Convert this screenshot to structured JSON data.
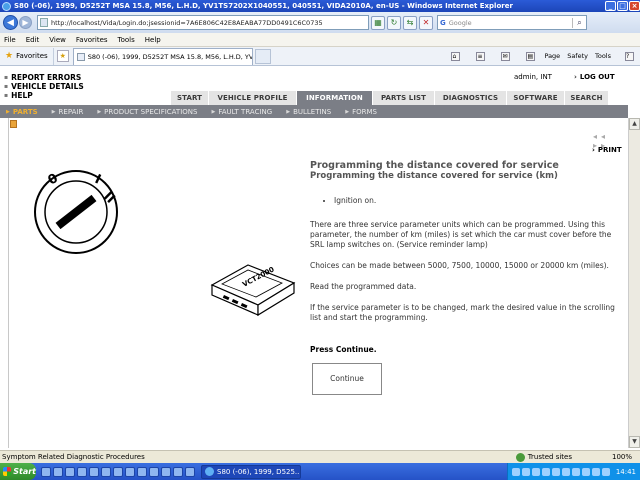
{
  "window": {
    "title": "S80 (-06), 1999, D5252T MSA 15.8, M56, L.H.D, YV1TS7202X1040551, 040551, VIDA2010A, en-US - Windows Internet Explorer"
  },
  "address_bar": {
    "url": "http://localhost/Vida/Login.do;jsessionid=7A6E806C42E8AEABA77DD0491C6C0735",
    "search_placeholder": "Google"
  },
  "menu": [
    "File",
    "Edit",
    "View",
    "Favorites",
    "Tools",
    "Help"
  ],
  "favorites": {
    "label": "Favorites",
    "tab_title": "S80 (-06), 1999, D5252T MSA 15.8, M56, L.H.D, YV1...",
    "commands": [
      "Page",
      "Safety",
      "Tools"
    ]
  },
  "app": {
    "left_links": [
      "REPORT ERRORS",
      "VEHICLE DETAILS",
      "HELP"
    ],
    "user": "admin, INT",
    "logout": "LOG OUT",
    "main_tabs": [
      {
        "label": "START",
        "active": false
      },
      {
        "label": "VEHICLE PROFILE",
        "active": false
      },
      {
        "label": "INFORMATION",
        "active": true
      },
      {
        "label": "PARTS LIST",
        "active": false
      },
      {
        "label": "DIAGNOSTICS",
        "active": false
      },
      {
        "label": "SOFTWARE",
        "active": false
      },
      {
        "label": "SEARCH",
        "active": false
      }
    ],
    "sub_nav": [
      {
        "label": "PARTS",
        "active": true
      },
      {
        "label": "REPAIR",
        "active": false
      },
      {
        "label": "PRODUCT SPECIFICATIONS",
        "active": false
      },
      {
        "label": "FAULT TRACING",
        "active": false
      },
      {
        "label": "BULLETINS",
        "active": false
      },
      {
        "label": "FORMS",
        "active": false
      }
    ],
    "pager": "◂◂ ▸▸",
    "print": "PRINT"
  },
  "document": {
    "title": "Programming the distance covered for service",
    "subtitle": "Programming the distance covered for service (km)",
    "bullets": [
      "Ignition on."
    ],
    "paragraphs": [
      "There are three service parameter units which can be programmed. Using this parameter, the number of km (miles) is set which the car must cover before the SRL lamp switches on. (Service reminder lamp)",
      "Choices can be made between 5000, 7500, 10000, 15000 or 20000 km (miles).",
      "Read the programmed data.",
      "If the service parameter is to be changed, mark the desired value in the scrolling list and start the programming."
    ],
    "press_text": "Press Continue.",
    "continue_label": "Continue",
    "vci_label": "VCT2000",
    "ignition_positions": [
      "0",
      "I",
      "II"
    ]
  },
  "status_bar": {
    "text": "Symptom Related Diagnostic Procedures",
    "zone": "Trusted sites",
    "zoom": "100%"
  },
  "taskbar": {
    "start": "Start",
    "task": "S80 (-06), 1999, D525...",
    "clock": "14:41"
  }
}
